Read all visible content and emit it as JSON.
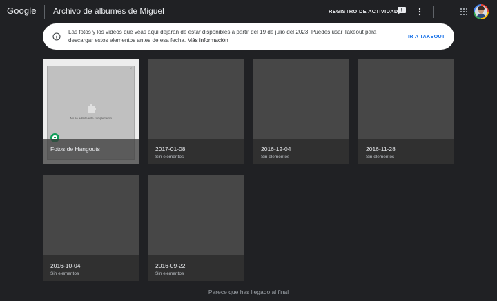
{
  "header": {
    "logo": "Google",
    "title": "Archivo de álbumes de Miguel",
    "activity_label": "REGISTRO DE ACTIVIDAD",
    "icons": [
      "feedback-icon",
      "more-vert-icon",
      "apps-icon",
      "avatar"
    ]
  },
  "banner": {
    "text": "Las fotos y los vídeos que veas aquí dejarán de estar disponibles a partir del 19 de julio del 2023. Puedes usar Takeout para descargar estos elementos antes de esa fecha.",
    "link": "Más información",
    "button": "IR A TAKEOUT",
    "icon": "info-icon"
  },
  "plugin": {
    "message": "No se admite este complemento.",
    "close": "×"
  },
  "albums": [
    {
      "name": "Fotos de Hangouts",
      "count": ""
    },
    {
      "name": "2017-01-08",
      "count": "Sin elementos"
    },
    {
      "name": "2016-12-04",
      "count": "Sin elementos"
    },
    {
      "name": "2016-11-28",
      "count": "Sin elementos"
    },
    {
      "name": "2016-10-04",
      "count": "Sin elementos"
    },
    {
      "name": "2016-09-22",
      "count": "Sin elementos"
    }
  ],
  "footer": "Parece que has llegado al final",
  "colors": {
    "background": "#202124",
    "tile": "#474747",
    "caption": "#303030",
    "accent": "#1a73e8",
    "hangouts": "#0f9d58"
  }
}
